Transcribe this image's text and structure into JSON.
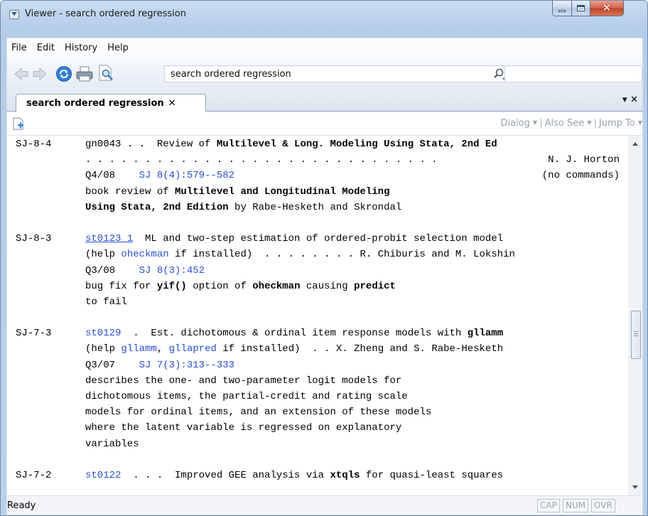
{
  "window": {
    "title": "Viewer - search ordered regression"
  },
  "menu": [
    "File",
    "Edit",
    "History",
    "Help"
  ],
  "toolbar": {
    "search_value": "search ordered regression",
    "find_value": ""
  },
  "tab": {
    "label": "search ordered regression",
    "close": "✕",
    "menu": "▾ ✕"
  },
  "viewer_links": {
    "dialog": "Dialog",
    "also_see": "Also See",
    "jump_to": "Jump To"
  },
  "entries": [
    {
      "id": "SJ-8-4",
      "code": "gn0043",
      "lines": {
        "l1_pre": " . .  Review of ",
        "l1_bold": "Multilevel & Long. Modeling Using Stata, 2nd Ed",
        "l2_dots": ". . . . . . . . . . . . . . . . . . . . . . . . . . . . . .",
        "l2_author": "N. J. Horton",
        "date": "Q4/08",
        "ref": "SJ 8(4):579--582",
        "note": "(no commands)",
        "d1_pre": "book review of ",
        "d1_bold": "Multilevel and Longitudinal Modeling",
        "d2_bold": "Using Stata, 2nd Edition",
        "d2_post": " by Rabe-Hesketh and Skrondal"
      }
    },
    {
      "id": "SJ-8-3",
      "code": "st0123_1",
      "lines": {
        "l1": "  ML and two-step estimation of ordered-probit selection model",
        "l2_pre": "(help ",
        "l2_link": "oheckman",
        "l2_post": " if installed)  . . . . . . . . R. Chiburis and M. Lokshin",
        "date": "Q3/08",
        "ref": "SJ 8(3):452",
        "d1_a": "bug fix for ",
        "d1_b": "yif()",
        "d1_c": " option of ",
        "d1_d": "oheckman",
        "d1_e": " causing ",
        "d1_f": "predict",
        "d2": "to fail"
      }
    },
    {
      "id": "SJ-7-3",
      "code": "st0129",
      "lines": {
        "l1_pre": "  .  Est. dichotomous & ordinal item response models with ",
        "l1_bold": "gllamm",
        "l2_pre": "(help ",
        "l2_link1": "gllamm",
        "l2_mid": ", ",
        "l2_link2": "gllapred",
        "l2_post": " if installed)  . . X. Zheng and S. Rabe-Hesketh",
        "date": "Q3/07",
        "ref": "SJ 7(3):313--333",
        "desc": [
          "describes the one- and two-parameter logit models for",
          "dichotomous items, the partial-credit and rating scale",
          "models for ordinal items, and an extension of these models",
          "where the latent variable is regressed on explanatory",
          "variables"
        ]
      }
    },
    {
      "id": "SJ-7-2",
      "code": "st0122",
      "lines": {
        "l1_pre": "  . . .  Improved GEE analysis via ",
        "l1_bold": "xtqls",
        "l1_post": " for quasi-least squares"
      }
    }
  ],
  "status": {
    "text": "Ready",
    "cap": "CAP",
    "num": "NUM",
    "ovr": "OVR"
  },
  "colors": {
    "link": "#2a4fd6",
    "close_button": "#c04328"
  }
}
